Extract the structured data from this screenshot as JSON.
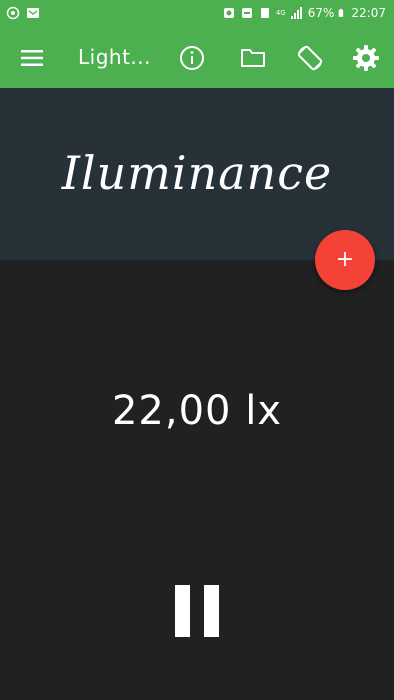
{
  "status_bar": {
    "data_type": "4G",
    "battery": "67%",
    "time": "22:07"
  },
  "toolbar": {
    "title": "Light..."
  },
  "sensor": {
    "name": "Iluminance",
    "reading": "22,00 lx"
  },
  "fab": {
    "label": "+"
  },
  "colors": {
    "toolbar": "#4caf50",
    "header": "#263238",
    "body": "#212121",
    "fab": "#f44336"
  },
  "icons": [
    "menu-icon",
    "info-icon",
    "folder-icon",
    "screen-rotation-icon",
    "settings-icon",
    "pause-icon"
  ]
}
